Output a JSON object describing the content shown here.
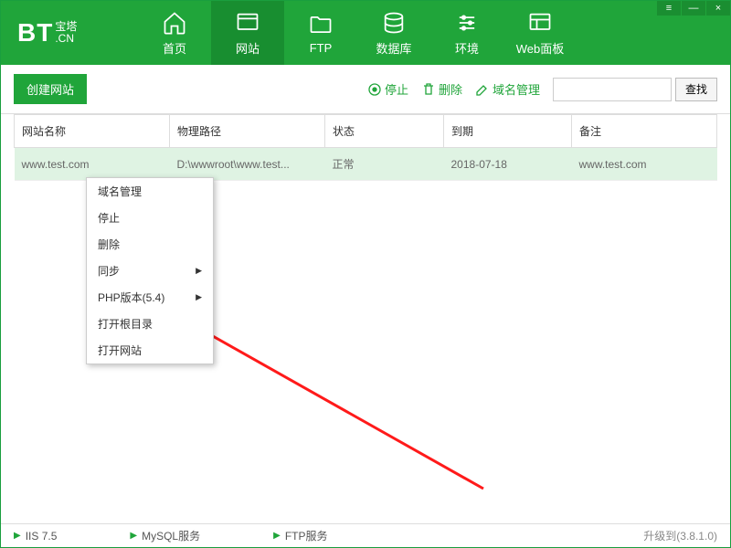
{
  "logo": {
    "bt": "BT",
    "zh": "宝塔",
    "cn": ".CN"
  },
  "nav": {
    "home": "首页",
    "site": "网站",
    "ftp": "FTP",
    "db": "数据库",
    "env": "环境",
    "panel": "Web面板"
  },
  "toolbar": {
    "create": "创建网站",
    "stop": "停止",
    "delete": "删除",
    "domain": "域名管理",
    "search": "查找"
  },
  "table": {
    "headers": {
      "name": "网站名称",
      "path": "物理路径",
      "status": "状态",
      "expire": "到期",
      "remark": "备注"
    },
    "row": {
      "name": "www.test.com",
      "path": "D:\\wwwroot\\www.test...",
      "status": "正常",
      "expire": "2018-07-18",
      "remark": "www.test.com"
    }
  },
  "menu": {
    "domain": "域名管理",
    "stop": "停止",
    "delete": "删除",
    "sync": "同步",
    "php": "PHP版本(5.4)",
    "openRoot": "打开根目录",
    "openSite": "打开网站"
  },
  "status": {
    "iis": "IIS 7.5",
    "mysql": "MySQL服务",
    "ftp": "FTP服务",
    "upgrade": "升级到(3.8.1.0)"
  }
}
